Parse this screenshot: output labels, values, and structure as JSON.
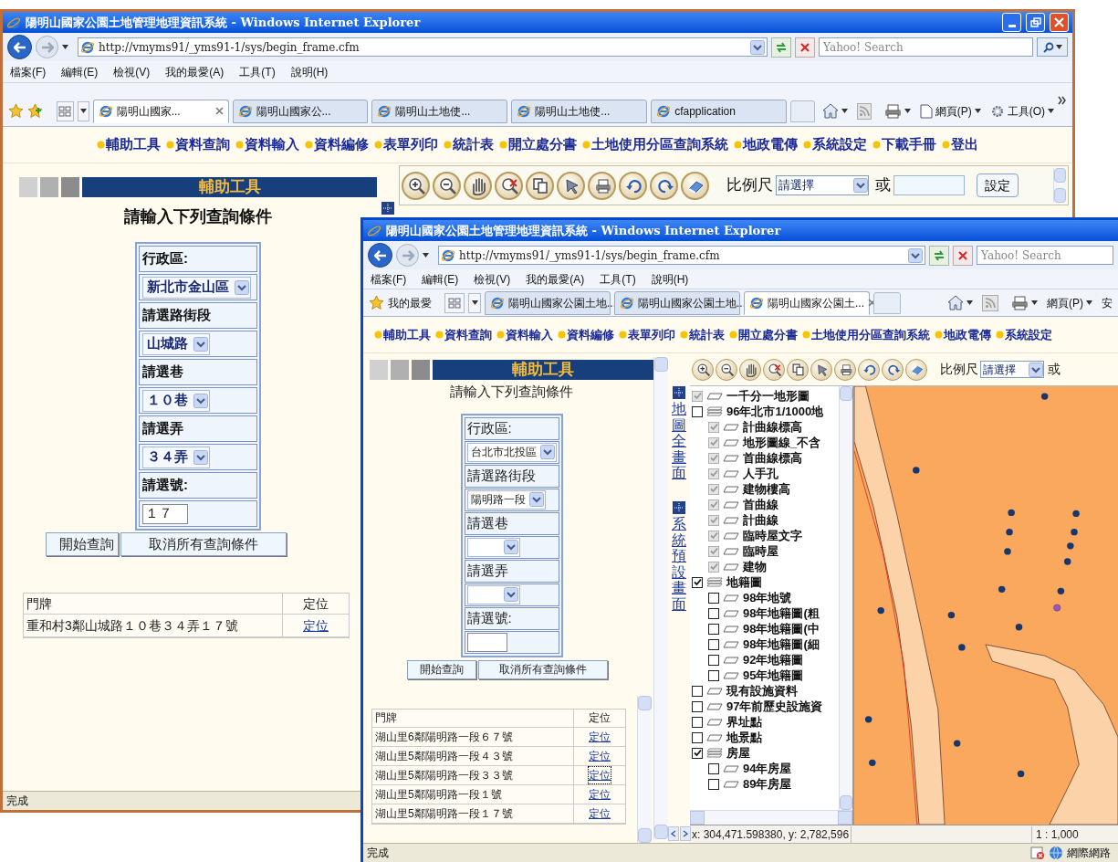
{
  "windows": [
    {
      "title": "陽明山國家公園土地管理地理資訊系統 - Windows Internet Explorer",
      "title_buttons": true,
      "address": "http://vmyms91/_yms91-1/sys/begin_frame.cfm",
      "search": {
        "placeholder": "Yahoo! Search"
      },
      "menu": [
        "檔案(F)",
        "編輯(E)",
        "檢視(V)",
        "我的最愛(A)",
        "工具(T)",
        "說明(H)"
      ],
      "tabs": [
        {
          "label": "陽明山國家...",
          "selected": true
        },
        {
          "label": "陽明山國家公...",
          "selected": false
        },
        {
          "label": "陽明山土地使...",
          "selected": false
        },
        {
          "label": "陽明山土地使...",
          "selected": false
        },
        {
          "label": "cfapplication",
          "selected": false
        }
      ],
      "command_items": [
        "網頁(P)",
        "工具(O)"
      ],
      "nav_links": [
        "輔助工具",
        "資料查詢",
        "資料輸入",
        "資料編修",
        "表單列印",
        "統計表",
        "開立處分書",
        "土地使用分區查詢系統",
        "地政電傳",
        "系統設定",
        "下載手冊",
        "登出"
      ],
      "panel_title": "輔助工具",
      "form_heading": "請輸入下列查詢條件",
      "bold_form": true,
      "form_rows": [
        {
          "kind": "label",
          "text": "行政區:"
        },
        {
          "kind": "select",
          "value": "新北市金山區"
        },
        {
          "kind": "label",
          "text": "請選路街段"
        },
        {
          "kind": "select",
          "value": "山城路"
        },
        {
          "kind": "label",
          "text": "請選巷"
        },
        {
          "kind": "select",
          "value": "１０巷"
        },
        {
          "kind": "label",
          "text": "請選弄"
        },
        {
          "kind": "select",
          "value": "３４弄"
        },
        {
          "kind": "label",
          "text": "請選號:"
        },
        {
          "kind": "input",
          "value": "１７"
        }
      ],
      "buttons": [
        "開始查詢",
        "取消所有查詢條件"
      ],
      "results": {
        "columns": [
          "門牌",
          "定位"
        ],
        "rows": [
          {
            "address": "重和村3鄰山城路１０巷３４弄１７號",
            "action": "定位",
            "focused": false
          }
        ]
      },
      "map_toolbar": {
        "scale_label": "比例尺",
        "scale_value": "請選擇",
        "or_label": "或",
        "set_button": "設定"
      },
      "status": "完成"
    },
    {
      "title": "陽明山國家公園土地管理地理資訊系統 - Windows Internet Explorer",
      "title_buttons": false,
      "address": "http://vmyms91/_yms91-1/sys/begin_frame.cfm",
      "search": {
        "placeholder": "Yahoo! Search"
      },
      "menu": [
        "檔案(F)",
        "編輯(E)",
        "檢視(V)",
        "我的最愛(A)",
        "工具(T)",
        "說明(H)"
      ],
      "favorites_label": "我的最愛",
      "tabs": [
        {
          "label": "陽明山國家公園土地...",
          "selected": false
        },
        {
          "label": "陽明山國家公園土地...",
          "selected": false
        },
        {
          "label": "陽明山國家公園土...",
          "selected": true
        }
      ],
      "command_items": [
        "網頁(P)",
        "安"
      ],
      "nav_links": [
        "輔助工具",
        "資料查詢",
        "資料輸入",
        "資料編修",
        "表單列印",
        "統計表",
        "開立處分書",
        "土地使用分區查詢系統",
        "地政電傳",
        "系統設定"
      ],
      "panel_title": "輔助工具",
      "form_heading": "請輸入下列查詢條件",
      "bold_form": false,
      "form_rows": [
        {
          "kind": "label",
          "text": "行政區:"
        },
        {
          "kind": "select",
          "value": "台北市北投區"
        },
        {
          "kind": "label",
          "text": "請選路街段"
        },
        {
          "kind": "select",
          "value": "陽明路一段"
        },
        {
          "kind": "label",
          "text": "請選巷"
        },
        {
          "kind": "select"
        },
        {
          "kind": "label",
          "text": "請選弄"
        },
        {
          "kind": "select"
        },
        {
          "kind": "label",
          "text": "請選號:"
        },
        {
          "kind": "input"
        }
      ],
      "buttons": [
        "開始查詢",
        "取消所有查詢條件"
      ],
      "results": {
        "columns": [
          "門牌",
          "定位"
        ],
        "rows": [
          {
            "address": "湖山里6鄰陽明路一段６７號",
            "action": "定位",
            "focused": false
          },
          {
            "address": "湖山里5鄰陽明路一段４３號",
            "action": "定位",
            "focused": false
          },
          {
            "address": "湖山里5鄰陽明路一段３３號",
            "action": "定位",
            "focused": true
          },
          {
            "address": "湖山里5鄰陽明路一段１號",
            "action": "定位",
            "focused": false
          },
          {
            "address": "湖山里5鄰陽明路一段１７號",
            "action": "定位",
            "focused": false
          }
        ]
      },
      "map_toolbar": {
        "scale_label": "比例尺",
        "scale_value": "請選擇",
        "or_label": "或"
      },
      "side_links": [
        "地圖全畫面",
        "系統預設畫面"
      ],
      "layers": [
        {
          "label": "一千分一地形圖",
          "kind": "layer",
          "checked": true,
          "disabled": true
        },
        {
          "label": "96年北市1/1000地",
          "kind": "group",
          "checked": false,
          "disabled": false,
          "children": [
            {
              "label": "計曲線標高",
              "kind": "layer",
              "checked": true,
              "disabled": true
            },
            {
              "label": "地形圖線_不含",
              "kind": "layer",
              "checked": true,
              "disabled": true
            },
            {
              "label": "首曲線標高",
              "kind": "layer",
              "checked": true,
              "disabled": true
            },
            {
              "label": "人手孔",
              "kind": "layer",
              "checked": true,
              "disabled": true
            },
            {
              "label": "建物樓高",
              "kind": "layer",
              "checked": true,
              "disabled": true
            },
            {
              "label": "首曲線",
              "kind": "layer",
              "checked": true,
              "disabled": true
            },
            {
              "label": "計曲線",
              "kind": "layer",
              "checked": true,
              "disabled": true
            },
            {
              "label": "臨時屋文字",
              "kind": "layer",
              "checked": true,
              "disabled": true
            },
            {
              "label": "臨時屋",
              "kind": "layer",
              "checked": true,
              "disabled": true
            },
            {
              "label": "建物",
              "kind": "layer",
              "checked": true,
              "disabled": true
            }
          ]
        },
        {
          "label": "地籍圖",
          "kind": "group",
          "checked": true,
          "disabled": false,
          "children": [
            {
              "label": "98年地號",
              "kind": "layer",
              "checked": false,
              "disabled": false
            },
            {
              "label": "98年地籍圖(粗",
              "kind": "layer",
              "checked": false,
              "disabled": false
            },
            {
              "label": "98年地籍圖(中",
              "kind": "layer",
              "checked": false,
              "disabled": false
            },
            {
              "label": "98年地籍圖(細",
              "kind": "layer",
              "checked": false,
              "disabled": false
            },
            {
              "label": "92年地籍圖",
              "kind": "layer",
              "checked": false,
              "disabled": false
            },
            {
              "label": "95年地籍圖",
              "kind": "layer",
              "checked": false,
              "disabled": false
            }
          ]
        },
        {
          "label": "現有設施資料",
          "kind": "layer",
          "checked": false,
          "disabled": false
        },
        {
          "label": "97年前歷史設施資",
          "kind": "layer",
          "checked": false,
          "disabled": false
        },
        {
          "label": "界址點",
          "kind": "layer",
          "checked": false,
          "disabled": false
        },
        {
          "label": "地景點",
          "kind": "layer",
          "checked": false,
          "disabled": false
        },
        {
          "label": "房屋",
          "kind": "group",
          "checked": true,
          "disabled": false,
          "children": [
            {
              "label": "94年房屋",
              "kind": "layer",
              "checked": false,
              "disabled": false
            },
            {
              "label": "89年房屋",
              "kind": "layer",
              "checked": false,
              "disabled": false
            }
          ]
        }
      ],
      "coordinates": "x: 304,471.598380, y: 2,782,596",
      "map_scale": "1 : 1,000",
      "zone": "網際網路",
      "status": "完成"
    }
  ]
}
